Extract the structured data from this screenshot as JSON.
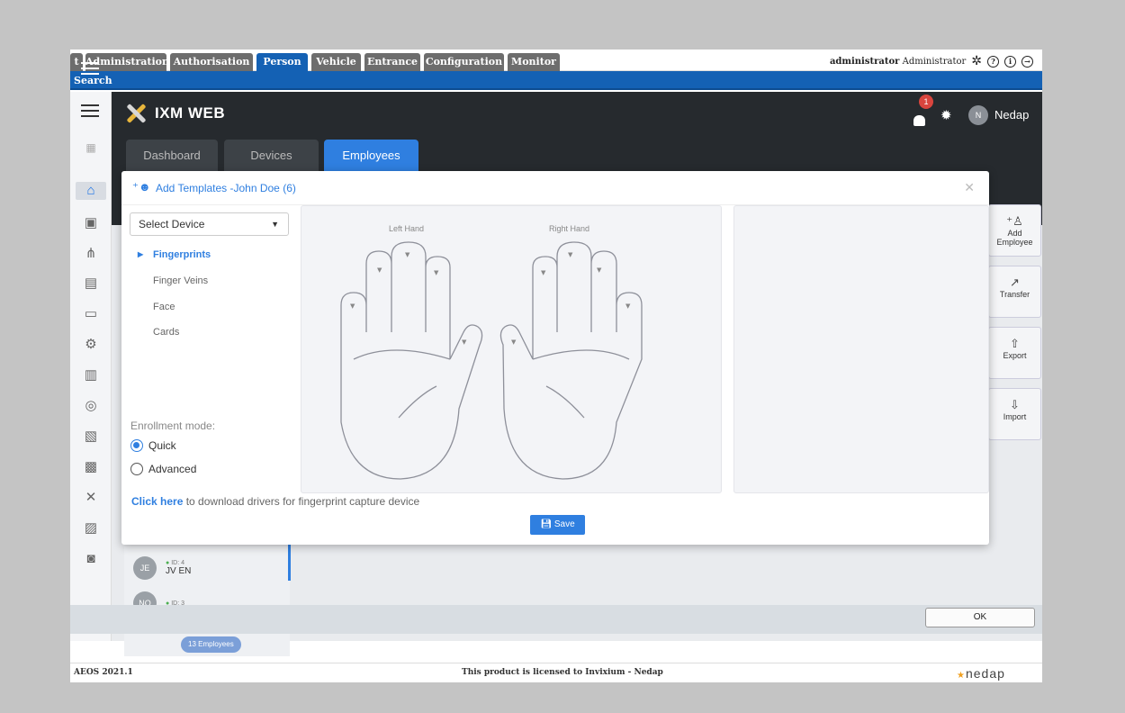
{
  "topmenu": {
    "tabs": [
      {
        "label": "t"
      },
      {
        "label": "Administration"
      },
      {
        "label": "Authorisation"
      },
      {
        "label": "Person"
      },
      {
        "label": "Vehicle"
      },
      {
        "label": "Entrance"
      },
      {
        "label": "Configuration"
      },
      {
        "label": "Monitor"
      }
    ],
    "active": "Person",
    "user_login": "administrator",
    "user_name": "Administrator"
  },
  "subbar": {
    "label": "Search"
  },
  "app": {
    "title": "IXM WEB",
    "tabs": [
      {
        "label": "Dashboard"
      },
      {
        "label": "Devices"
      },
      {
        "label": "Employees"
      }
    ],
    "active_tab": "Employees",
    "notification_count": "1",
    "user_initial": "N",
    "user_name": "Nedap"
  },
  "right_actions": [
    {
      "label": "Add\nEmployee",
      "icon": "add-person-icon"
    },
    {
      "label": "Transfer",
      "icon": "arrow-up-right-icon"
    },
    {
      "label": "Export",
      "icon": "export-icon"
    },
    {
      "label": "Import",
      "icon": "import-icon"
    }
  ],
  "modal": {
    "title": "Add Templates -John Doe (6)",
    "select_device": "Select Device",
    "options": [
      {
        "label": "Fingerprints",
        "active": true
      },
      {
        "label": "Finger Veins",
        "active": false
      },
      {
        "label": "Face",
        "active": false
      },
      {
        "label": "Cards",
        "active": false
      }
    ],
    "enrollment_label": "Enrollment mode:",
    "modes": [
      {
        "label": "Quick",
        "selected": true
      },
      {
        "label": "Advanced",
        "selected": false
      }
    ],
    "left_hand": "Left Hand",
    "right_hand": "Right Hand",
    "download_link": "Click here",
    "download_text": " to download drivers for fingerprint capture device",
    "save_label": "Save"
  },
  "employees": [
    {
      "initials": "JE",
      "id": "ID: 4",
      "name": "JV EN"
    },
    {
      "initials": "NO",
      "id": "ID: 3",
      "name": ""
    }
  ],
  "employee_count": "13 Employees",
  "dialog": {
    "ok_label": "OK"
  },
  "footer": {
    "version": "AEOS 2021.1",
    "license": "This product is licensed to Invixium - Nedap",
    "brand": "nedap"
  },
  "colors": {
    "accent": "#2f7fe0",
    "topnav": "#1461b4",
    "header": "#262a2e"
  }
}
